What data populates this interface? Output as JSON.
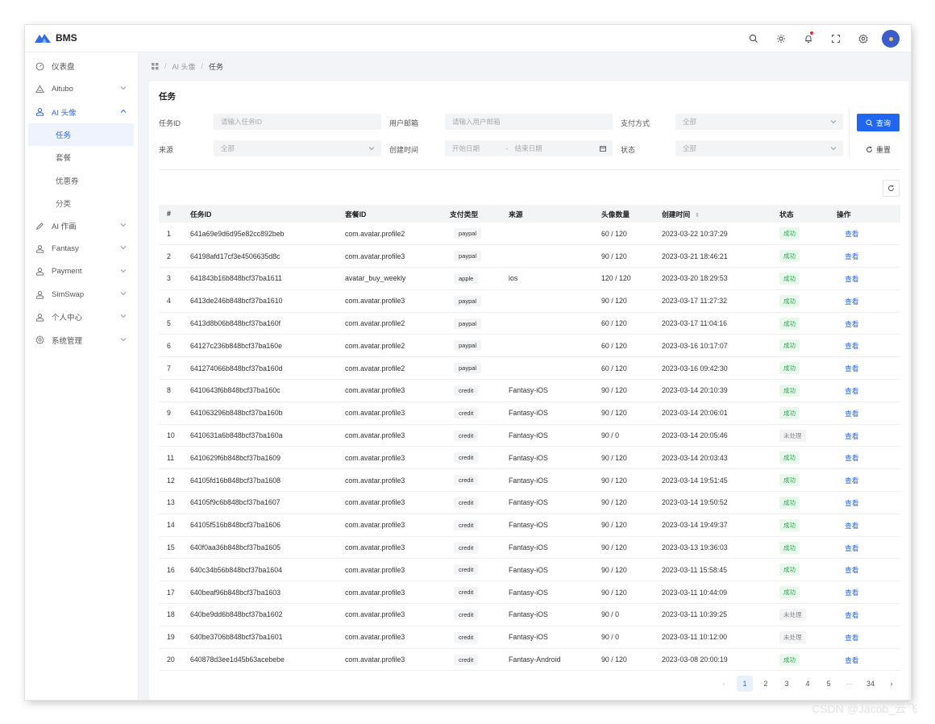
{
  "app": {
    "name": "BMS"
  },
  "colors": {
    "primary": "#1f67f2",
    "success": "#27a74a",
    "brand_logo": "#2f6bea"
  },
  "topbar_icons": [
    "search-icon",
    "sun-icon",
    "bell-icon",
    "fullscreen-icon",
    "settings-icon",
    "avatar"
  ],
  "sidebar": {
    "items": [
      {
        "label": "仪表盘",
        "icon": "dashboard-icon",
        "has_children": false
      },
      {
        "label": "Aitubo",
        "icon": "triangle-icon",
        "has_children": true
      },
      {
        "label": "AI 头像",
        "icon": "user-icon",
        "has_children": true,
        "expanded": true,
        "children": [
          "任务",
          "套餐",
          "优惠券",
          "分类"
        ],
        "active_child": "任务"
      },
      {
        "label": "AI 作画",
        "icon": "pen-icon",
        "has_children": true
      },
      {
        "label": "Fantasy",
        "icon": "user-icon",
        "has_children": true
      },
      {
        "label": "Payment",
        "icon": "user-icon",
        "has_children": true
      },
      {
        "label": "SimSwap",
        "icon": "user-icon",
        "has_children": true
      },
      {
        "label": "个人中心",
        "icon": "user-icon",
        "has_children": true
      },
      {
        "label": "系统管理",
        "icon": "gear-icon",
        "has_children": true
      }
    ]
  },
  "breadcrumb": {
    "sep": "/",
    "items": [
      "AI 头像",
      "任务"
    ]
  },
  "page": {
    "title": "任务"
  },
  "filters": {
    "task_id": {
      "label": "任务ID",
      "placeholder": "请输入任务ID"
    },
    "email": {
      "label": "用户邮箱",
      "placeholder": "请输入用户邮箱"
    },
    "pay_method": {
      "label": "支付方式",
      "value": "全部"
    },
    "source": {
      "label": "来源",
      "value": "全部"
    },
    "created": {
      "label": "创建时间",
      "start": "开始日期",
      "dash": "-",
      "end": "结束日期"
    },
    "status": {
      "label": "状态",
      "value": "全部"
    },
    "query_label": "查询",
    "reset_label": "重置"
  },
  "table": {
    "columns": [
      "#",
      "任务ID",
      "套餐ID",
      "支付类型",
      "来源",
      "头像数量",
      "创建时间",
      "状态",
      "操作"
    ],
    "sort_glyph": "⇕",
    "rows": [
      [
        "1",
        "641a69e9d6d95e82cc892beb",
        "com.avatar.profile2",
        "paypal",
        "",
        "60 / 120",
        "2023-03-22 10:37:29",
        "成功",
        "查看"
      ],
      [
        "2",
        "64198afd17cf3e4506635d8c",
        "com.avatar.profile3",
        "paypal",
        "",
        "90 / 120",
        "2023-03-21 18:46:21",
        "成功",
        "查看"
      ],
      [
        "3",
        "641843b16b848bcf37ba1611",
        "avatar_buy_weekly",
        "apple",
        "ios",
        "120 / 120",
        "2023-03-20 18:29:53",
        "成功",
        "查看"
      ],
      [
        "4",
        "6413de246b848bcf37ba1610",
        "com.avatar.profile3",
        "paypal",
        "",
        "90 / 120",
        "2023-03-17 11:27:32",
        "成功",
        "查看"
      ],
      [
        "5",
        "6413d8b06b848bcf37ba160f",
        "com.avatar.profile2",
        "paypal",
        "",
        "60 / 120",
        "2023-03-17 11:04:16",
        "成功",
        "查看"
      ],
      [
        "6",
        "64127c236b848bcf37ba160e",
        "com.avatar.profile2",
        "paypal",
        "",
        "60 / 120",
        "2023-03-16 10:17:07",
        "成功",
        "查看"
      ],
      [
        "7",
        "641274066b848bcf37ba160d",
        "com.avatar.profile2",
        "paypal",
        "",
        "60 / 120",
        "2023-03-16 09:42:30",
        "成功",
        "查看"
      ],
      [
        "8",
        "6410643f6b848bcf37ba160c",
        "com.avatar.profile3",
        "credit",
        "Fantasy-iOS",
        "90 / 120",
        "2023-03-14 20:10:39",
        "成功",
        "查看"
      ],
      [
        "9",
        "641063296b848bcf37ba160b",
        "com.avatar.profile3",
        "credit",
        "Fantasy-iOS",
        "90 / 120",
        "2023-03-14 20:06:01",
        "成功",
        "查看"
      ],
      [
        "10",
        "6410631a6b848bcf37ba160a",
        "com.avatar.profile3",
        "credit",
        "Fantasy-iOS",
        "90 / 0",
        "2023-03-14 20:05:46",
        "未处理",
        "查看"
      ],
      [
        "11",
        "6410629f6b848bcf37ba1609",
        "com.avatar.profile3",
        "credit",
        "Fantasy-iOS",
        "90 / 120",
        "2023-03-14 20:03:43",
        "成功",
        "查看"
      ],
      [
        "12",
        "64105fd16b848bcf37ba1608",
        "com.avatar.profile3",
        "credit",
        "Fantasy-iOS",
        "90 / 120",
        "2023-03-14 19:51:45",
        "成功",
        "查看"
      ],
      [
        "13",
        "64105f9c6b848bcf37ba1607",
        "com.avatar.profile3",
        "credit",
        "Fantasy-iOS",
        "90 / 120",
        "2023-03-14 19:50:52",
        "成功",
        "查看"
      ],
      [
        "14",
        "64105f516b848bcf37ba1606",
        "com.avatar.profile3",
        "credit",
        "Fantasy-iOS",
        "90 / 120",
        "2023-03-14 19:49:37",
        "成功",
        "查看"
      ],
      [
        "15",
        "640f0aa36b848bcf37ba1605",
        "com.avatar.profile3",
        "credit",
        "Fantasy-iOS",
        "90 / 120",
        "2023-03-13 19:36:03",
        "成功",
        "查看"
      ],
      [
        "16",
        "640c34b56b848bcf37ba1604",
        "com.avatar.profile3",
        "credit",
        "Fantasy-iOS",
        "90 / 120",
        "2023-03-11 15:58:45",
        "成功",
        "查看"
      ],
      [
        "17",
        "640beaf96b848bcf37ba1603",
        "com.avatar.profile3",
        "credit",
        "Fantasy-iOS",
        "90 / 120",
        "2023-03-11 10:44:09",
        "成功",
        "查看"
      ],
      [
        "18",
        "640be9dd6b848bcf37ba1602",
        "com.avatar.profile3",
        "credit",
        "Fantasy-iOS",
        "90 / 0",
        "2023-03-11 10:39:25",
        "未处理",
        "查看"
      ],
      [
        "19",
        "640be3706b848bcf37ba1601",
        "com.avatar.profile3",
        "credit",
        "Fantasy-iOS",
        "90 / 0",
        "2023-03-11 10:12:00",
        "未处理",
        "查看"
      ],
      [
        "20",
        "640878d3ee1d45b63acebebe",
        "com.avatar.profile3",
        "credit",
        "Fantasy-Android",
        "90 / 120",
        "2023-03-08 20:00:19",
        "成功",
        "查看"
      ]
    ]
  },
  "pagination": {
    "prev": "‹",
    "pages": [
      "1",
      "2",
      "3",
      "4",
      "5"
    ],
    "ellipsis": "···",
    "last": "34",
    "next": "›",
    "current": "1"
  },
  "watermark": "CSDN @Jacob_云飞"
}
